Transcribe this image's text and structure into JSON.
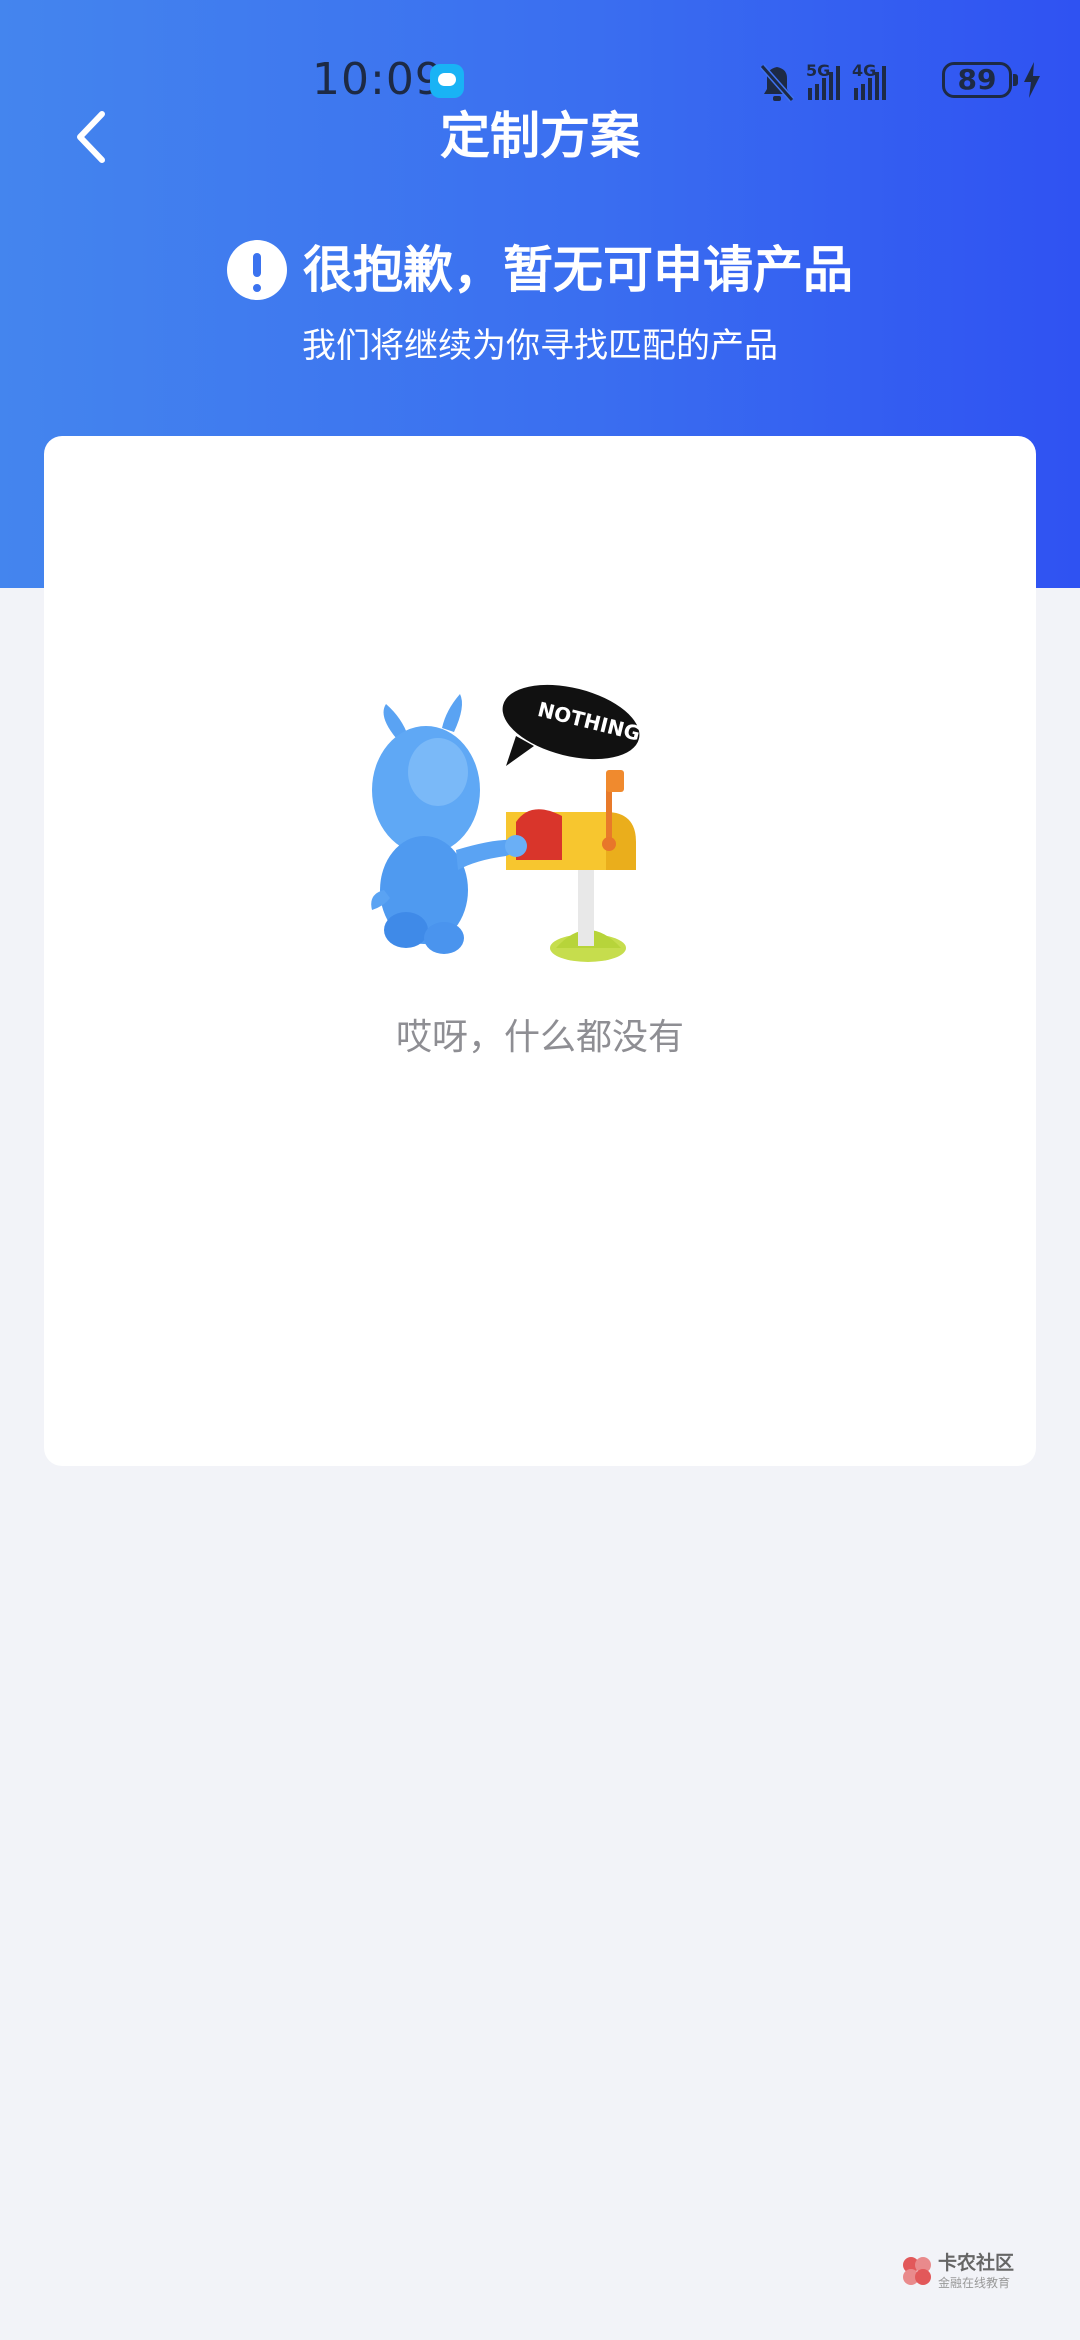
{
  "status_bar": {
    "time": "10:09",
    "signal_1_label": "5G",
    "signal_2_label": "4G",
    "battery": "89",
    "icons": [
      "message-app-icon",
      "bell-muted-icon",
      "signal-5g-icon",
      "signal-4g-icon",
      "battery-icon",
      "charging-icon"
    ]
  },
  "header": {
    "title": "定制方案",
    "back_icon": "chevron-left-icon"
  },
  "notice": {
    "icon": "exclamation-circle-icon",
    "title": "很抱歉，暂无可申请产品",
    "subtitle": "我们将继续为你寻找匹配的产品"
  },
  "empty_state": {
    "illustration_text": "NOTHING...",
    "message": "哎呀，什么都没有"
  },
  "watermark": {
    "name": "卡农社区",
    "sub": "金融在线教育"
  },
  "colors": {
    "header_gradient_start": "#4485ee",
    "header_gradient_end": "#2f52f2",
    "background": "#f2f3f8",
    "card": "#ffffff",
    "empty_text": "#8e8e93"
  }
}
